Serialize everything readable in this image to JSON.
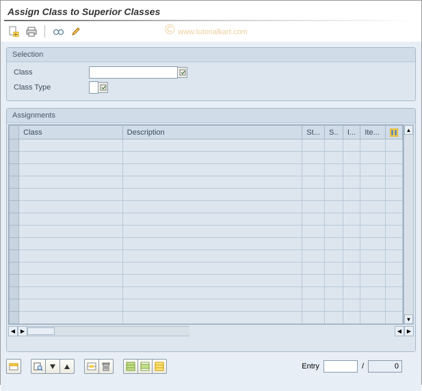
{
  "title": "Assign Class to Superior Classes",
  "watermark": "www.tutorialkart.com",
  "selection": {
    "panel_title": "Selection",
    "class_label": "Class",
    "class_value": "",
    "class_type_label": "Class Type",
    "class_type_value": ""
  },
  "assignments": {
    "panel_title": "Assignments",
    "columns": {
      "class": "Class",
      "description": "Description",
      "status": "St...",
      "s": "S..",
      "i": "I...",
      "item": "Ite..."
    },
    "row_count": 15
  },
  "footer": {
    "entry_label": "Entry",
    "entry_value": "",
    "entry_sep": "/",
    "entry_total": "0"
  }
}
